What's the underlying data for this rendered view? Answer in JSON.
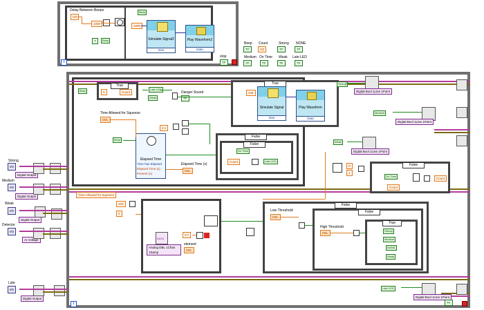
{
  "top_loop": {
    "delay_label": "Delay Between Beeps",
    "delay_type": "I32",
    "delay_value": "1000",
    "beep_local_1": "Beep",
    "beep_local_2": "Beep",
    "true_const": "T",
    "const_1000": "1000",
    "sim_title": "Simulate Signal2",
    "sim_sub": "Sine",
    "play_title": "Play Waveform2",
    "play_sub": "Data",
    "stop_label": "stop",
    "stop_type": "TF",
    "iter": "i"
  },
  "indicators": {
    "beep": "Beep",
    "count": "Count",
    "strong": "Strong",
    "none": "NONE",
    "medium": "Medium",
    "on_time": "On Time",
    "weak": "Weak",
    "late_led": "Late LED",
    "type_tf": "TF",
    "type_i32": "I32"
  },
  "main_loop": {
    "iter": "i",
    "beep_local": "Beep",
    "case_true_1": "True",
    "count_local_1": "Count",
    "late_led_local_1": "Late LED",
    "weak_local_1": "Weak",
    "danger_label": "Danger Sound",
    "case_true_2": "True",
    "const_445": "445",
    "sim_title": "Simulate Signal",
    "sim_sub": "Sine",
    "play_title": "Play Waveform",
    "play_sub": "Data",
    "strong_local": "Strong",
    "dbool_strong": "Digital Bool 1Line 1Point",
    "medium_local": "Medium",
    "dbool_medium": "Digital Bool 1Line 1Point",
    "time_allowed": "Time Allowed for Squeeze",
    "elapsed_title": "Elapsed Time",
    "elapsed_out_1": "Time has Elapsed",
    "elapsed_out_2": "Elapsed Time (s)",
    "elapsed_out_3": "Present (s)",
    "elapsed_label": "Elapsed Time (s)",
    "case_false_1": "False",
    "on_time_local": "On Time",
    "count_local_2": "Count",
    "late_led_local_2": "Late LED",
    "beep_local_2": "Beep",
    "const_0_1": "0.1",
    "weak_local_2": "Weak",
    "dbool_weak": "Digital Bool 1Line 1Point",
    "case_false_2": "False",
    "on_time_local_2": "On Time",
    "count_local_3": "Count",
    "count_local_4": "Count",
    "time_allowed_local": "Time Allowed for Squeeze",
    "const_100": "100",
    "const_0": "0",
    "analog_label": "Analog DBL 1Chan 1Samp",
    "element_label": "element",
    "const_0_7": "0.7",
    "case_false_3": "False",
    "low_threshold": "Low Threshold",
    "high_threshold": "High Threshold",
    "case_false_4": "False",
    "case_true_3": "True",
    "strong_local_2": "Strong",
    "medium_local_2": "Medium",
    "none_local": "NONE",
    "weak_local_3": "Weak",
    "late_led_local_3": "Late LED",
    "dbool_late": "Digital Bool 1Line 1Point",
    "stop_const": "TF",
    "data_tag": "DATA",
    "dbl_tag": "DBL"
  },
  "left_controls": {
    "strong_label": "Strong",
    "strong_ctl": "Digital Output",
    "medium_label": "Medium",
    "medium_ctl": "Digital Output",
    "weak_label": "Weak",
    "weak_ctl": "Digital Output",
    "detector_label": "Detector",
    "detector_ctl": "AI Voltage",
    "late_label": "Late",
    "late_ctl": "Digital Output"
  }
}
